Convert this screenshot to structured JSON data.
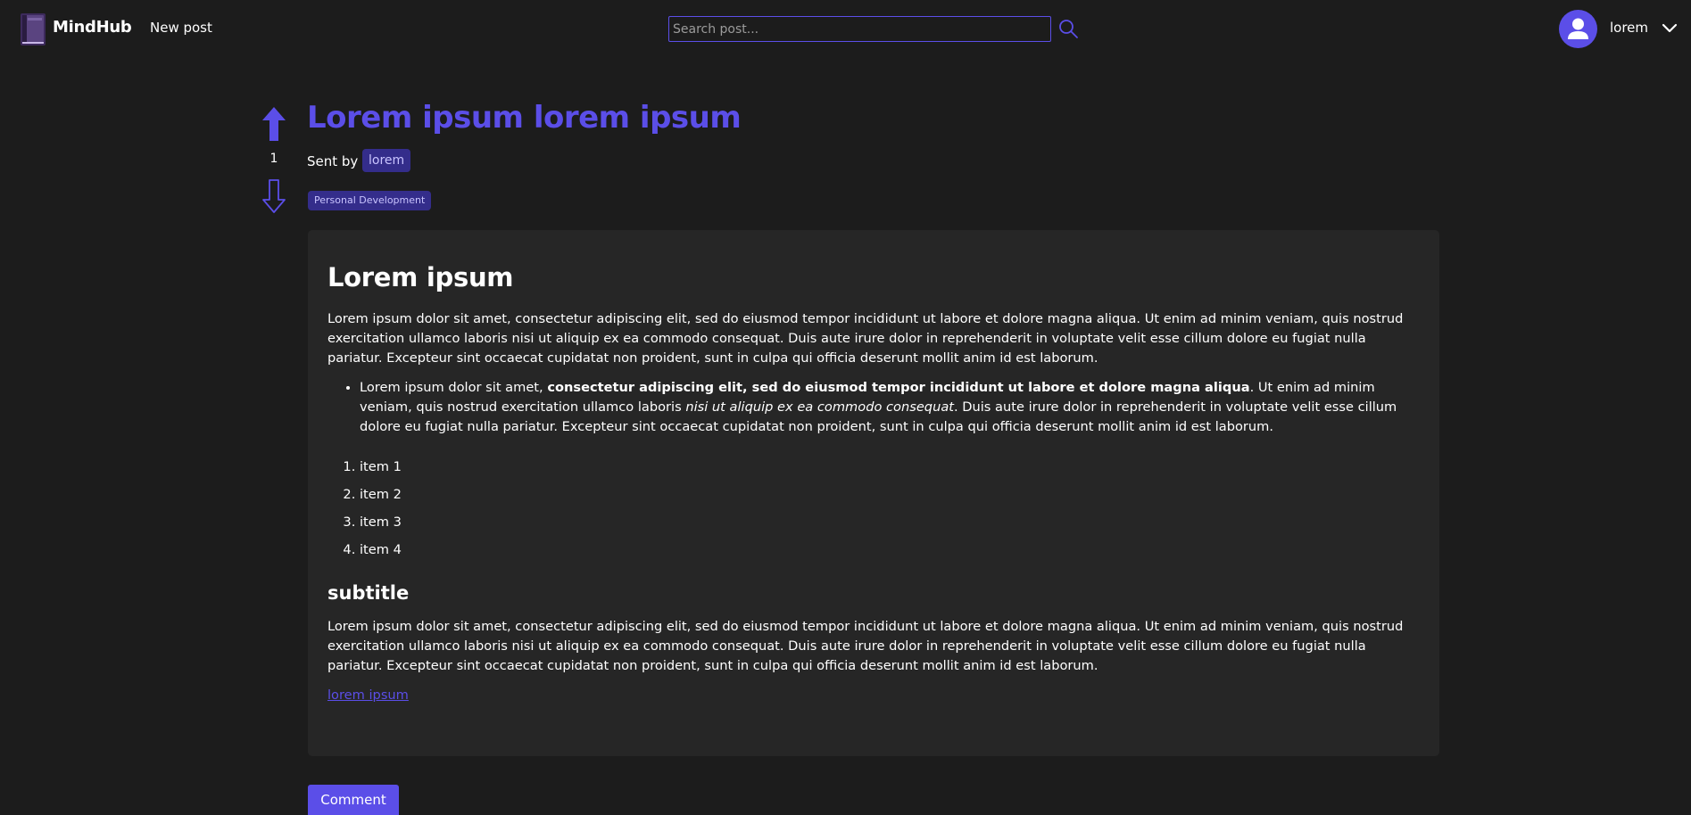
{
  "header": {
    "brand": "MindHub",
    "new_post_label": "New post",
    "search_placeholder": "Search post...",
    "username": "lorem"
  },
  "post": {
    "title": "Lorem ipsum lorem ipsum",
    "sent_by_label": "Sent by",
    "author": "lorem",
    "tag": "Personal Development",
    "votes": "1"
  },
  "body": {
    "heading": "Lorem ipsum",
    "paragraph1": "Lorem ipsum dolor sit amet, consectetur adipiscing elit, sed do eiusmod tempor incididunt ut labore et dolore magna aliqua. Ut enim ad minim veniam, quis nostrud exercitation ullamco laboris nisi ut aliquip ex ea commodo consequat. Duis aute irure dolor in reprehenderit in voluptate velit esse cillum dolore eu fugiat nulla pariatur. Excepteur sint occaecat cupidatat non proident, sunt in culpa qui officia deserunt mollit anim id est laborum.",
    "bullet": {
      "part1": "Lorem ipsum dolor sit amet, ",
      "bold": "consectetur adipiscing elit, sed do eiusmod tempor incididunt ut labore et dolore magna aliqua",
      "part2": ". Ut enim ad minim veniam, quis nostrud exercitation ullamco laboris ",
      "italic": "nisi ut aliquip ex ea commodo consequat",
      "part3": ". Duis aute irure dolor in reprehenderit in voluptate velit esse cillum dolore eu fugiat nulla pariatur. Excepteur sint occaecat cupidatat non proident, sunt in culpa qui officia deserunt mollit anim id est laborum."
    },
    "list_items": [
      "item 1",
      "item 2",
      "item 3",
      "item 4"
    ],
    "subtitle": "subtitle",
    "paragraph2": "Lorem ipsum dolor sit amet, consectetur adipiscing elit, sed do eiusmod tempor incididunt ut labore et dolore magna aliqua. Ut enim ad minim veniam, quis nostrud exercitation ullamco laboris nisi ut aliquip ex ea commodo consequat. Duis aute irure dolor in reprehenderit in voluptate velit esse cillum dolore eu fugiat nulla pariatur. Excepteur sint occaecat cupidatat non proident, sunt in culpa qui officia deserunt mollit anim id est laborum.",
    "link": "lorem ipsum"
  },
  "comment_label": "Comment",
  "colors": {
    "accent": "#5b4ee8",
    "background": "#1c1c1c",
    "card": "#262626",
    "badge": "#342d8b"
  },
  "icons": [
    "book-logo-icon",
    "search-icon",
    "user-icon",
    "chevron-down-icon",
    "arrow-up-icon",
    "arrow-down-icon"
  ]
}
